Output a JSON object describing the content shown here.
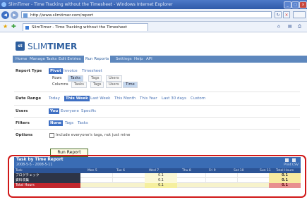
{
  "window": {
    "title": "SlimTimer - Time Tracking without the Timesheet - Windows Internet Explorer",
    "controls": [
      "_",
      "□",
      "×"
    ]
  },
  "browser": {
    "address": "http://www.slimtimer.com/report",
    "tab_title": "SlimTimer - Time Tracking without the Timesheet",
    "back": "◀",
    "forward": "▶",
    "go_refresh": "↻",
    "go_close": "×",
    "home": "⌂",
    "print": "⎙",
    "favorites": "★"
  },
  "app": {
    "logo_mark": "st",
    "logo_prefix": "SLIM",
    "logo_suffix": "TIMER"
  },
  "menu": {
    "items": [
      {
        "label": "Home"
      },
      {
        "label": "Manage Tasks"
      },
      {
        "label": "Edit Entries"
      },
      {
        "label": "Run Reports"
      },
      {
        "label": "Settings"
      },
      {
        "label": "Help"
      },
      {
        "label": "API"
      }
    ],
    "active_index": 3
  },
  "form": {
    "report_type": {
      "label": "Report Type",
      "options": [
        "Pivot",
        "Invoice",
        "Timesheet"
      ],
      "selected": "Pivot",
      "rows_label": "Rows",
      "rows_options": [
        "Tasks",
        "Tags",
        "Users"
      ],
      "rows_selected": "Tasks",
      "columns_label": "Columns",
      "columns_options": [
        "Tasks",
        "Tags",
        "Users",
        "Time"
      ],
      "columns_selected": "Time"
    },
    "date_range": {
      "label": "Date Range",
      "options": [
        "Today",
        "This Week",
        "Last Week",
        "This Month",
        "This Year",
        "Last 30 days",
        "Custom"
      ],
      "selected": "This Week"
    },
    "users": {
      "label": "Users",
      "options": [
        "You",
        "Everyone",
        "Specific"
      ],
      "selected": "You"
    },
    "filters": {
      "label": "Filters",
      "options": [
        "None",
        "Tags",
        "Tasks"
      ],
      "selected": "None"
    },
    "options": {
      "label": "Options",
      "checkbox_label": "Include everyone's tags, not just mine",
      "checked": false
    },
    "run_button": "Run Report"
  },
  "report": {
    "title": "Task by Time Report",
    "dates": "2008-5-5 - 2008-5-11",
    "print_csv": "Print CSV",
    "columns": [
      "Task",
      "Mon 5",
      "Tue 6",
      "Wed 7",
      "Thu 8",
      "Fri 9",
      "Sat 10",
      "Sun 11",
      "Total Hours"
    ],
    "rows": [
      {
        "task": "ブログチェック",
        "wed": "0.1",
        "total": "0.1"
      },
      {
        "task": "資料収集",
        "wed": "0.1",
        "total": "0.1"
      }
    ],
    "total_row": {
      "label": "Total Hours",
      "wed": "0.1",
      "total": "0.1"
    }
  }
}
